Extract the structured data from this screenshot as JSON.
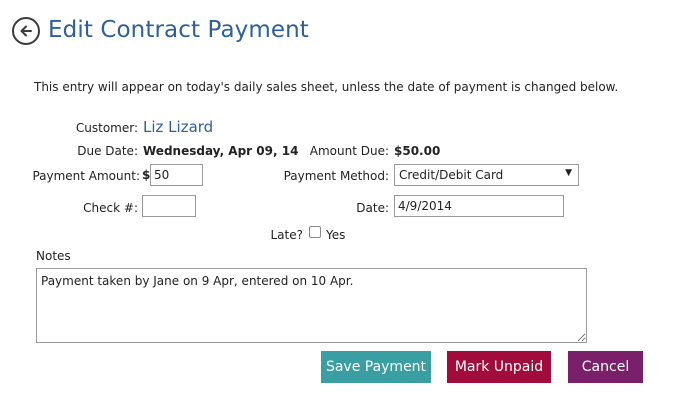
{
  "header": {
    "title": "Edit Contract Payment",
    "back_icon": "arrow-left-circle-icon"
  },
  "intro_text": "This entry will appear on today's daily sales sheet, unless the date of payment is changed below.",
  "customer": {
    "label": "Customer:",
    "name": "Liz Lizard"
  },
  "due_date": {
    "label": "Due Date:",
    "value": "Wednesday, Apr 09, 14"
  },
  "amount_due": {
    "label": "Amount Due:",
    "value": "$50.00"
  },
  "payment_amount": {
    "label": "Payment Amount:",
    "currency_symbol": "$",
    "value": "50"
  },
  "payment_method": {
    "label": "Payment Method:",
    "selected": "Credit/Debit Card",
    "caret": "▼"
  },
  "check_number": {
    "label": "Check #:",
    "value": ""
  },
  "payment_date": {
    "label": "Date:",
    "value": "4/9/2014"
  },
  "late": {
    "label": "Late?",
    "checkbox_label": "Yes",
    "checked": false
  },
  "notes": {
    "label": "Notes",
    "value": "Payment taken by Jane on 9 Apr, entered on 10 Apr."
  },
  "buttons": {
    "save": "Save Payment",
    "mark_unpaid": "Mark Unpaid",
    "cancel": "Cancel"
  },
  "colors": {
    "title": "#2d5f9a",
    "save_button": "#3a9fa3",
    "mark_unpaid_button": "#a10c3c",
    "cancel_button": "#7a1f6a"
  }
}
